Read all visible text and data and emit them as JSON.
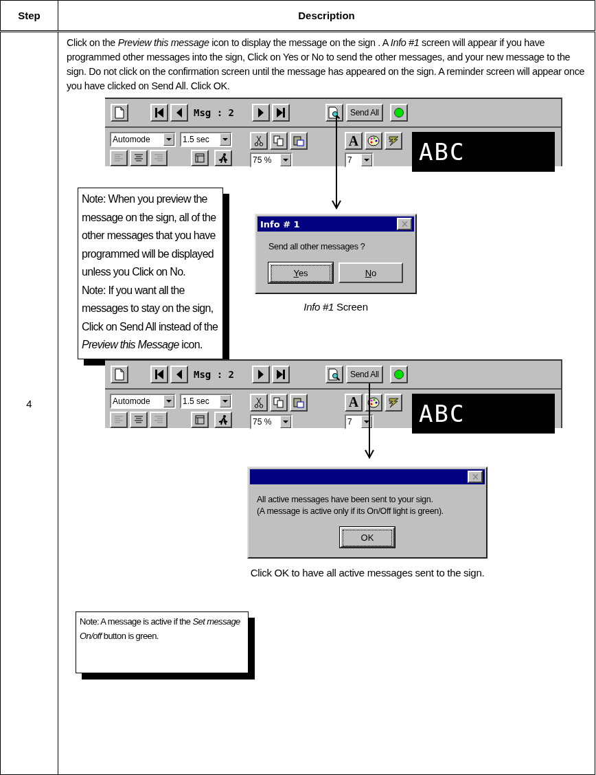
{
  "table": {
    "columns": [
      "Step",
      "Description"
    ],
    "rows": [
      {
        "step": "4",
        "description": "Click on the *Preview this message* icon to display the message on the sign . A *Info #1* screen will appear if you have programmed other messages into the sign, Click on Yes or No to send the other messages, and your new message to the sign. Do not click on the confirmation screen until the message has appeared on the sign. A reminder screen will appear once you have clicked on Send All. Click OK.",
        "toolbars": [
          {
            "message_label": "Msg : 2",
            "send_all": "Send All",
            "message_on": true,
            "mode": "Automode",
            "duration": "1.5 sec",
            "zoom": "75 %",
            "font_button": "A",
            "font_size": "7",
            "sign_text": "ABC"
          },
          {
            "message_label": "Msg : 2",
            "send_all": "Send All",
            "message_on": true,
            "mode": "Automode",
            "duration": "1.5 sec",
            "zoom": "75 %",
            "font_button": "A",
            "font_size": "7",
            "sign_text": "ABC"
          }
        ],
        "note_1": [
          "Note: When you preview the message on the sign, all of the other messages that you have programmed will be displayed unless you Click on No.",
          "Note: If you want all the messages to stay on the sign, Click on Send All instead of the *Preview this Message* icon."
        ],
        "dialogs": [
          {
            "title": "Info # 1",
            "message_lines": [
              "Send all other messages ?"
            ],
            "buttons": [
              {
                "label": "Yes",
                "default": true
              },
              {
                "label": "No",
                "default": false
              }
            ],
            "caption": "*Info #1* Screen"
          },
          {
            "message_lines": [
              "All active messages have been sent to your sign.",
              "(A message is active only if its On/Off light is green)."
            ],
            "buttons": [
              {
                "label": "OK",
                "default": true
              }
            ],
            "caption": "Click OK to have all active messages sent to the sign."
          }
        ],
        "note_2": "Note: A message is active if the *Set message On/off* button is green."
      }
    ]
  }
}
